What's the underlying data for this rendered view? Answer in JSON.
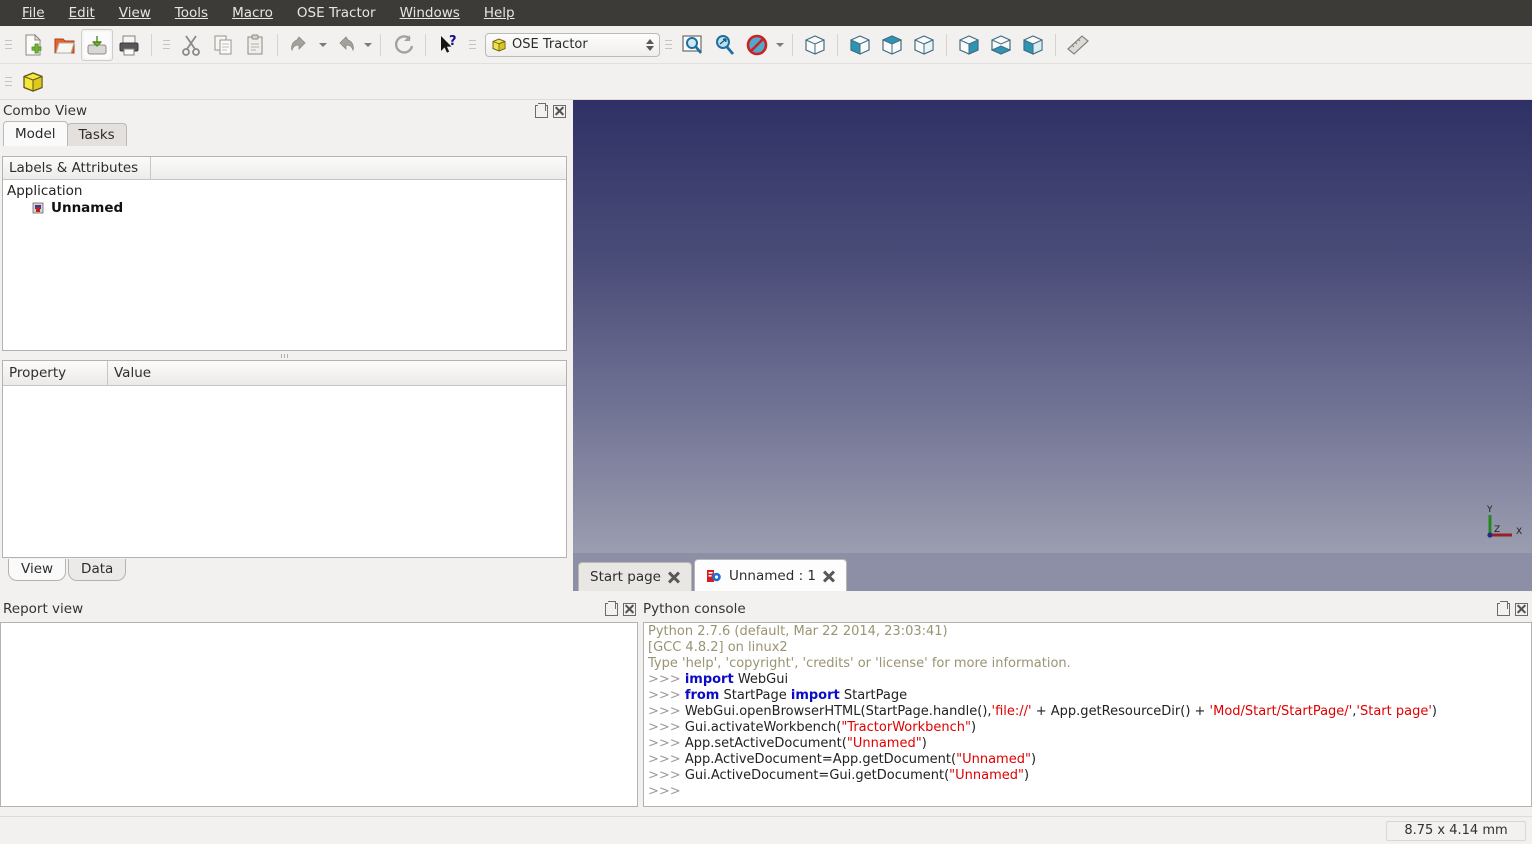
{
  "menubar": {
    "items": [
      {
        "label": "File",
        "mnemonic": "F"
      },
      {
        "label": "Edit",
        "mnemonic": "E"
      },
      {
        "label": "View",
        "mnemonic": "V"
      },
      {
        "label": "Tools",
        "mnemonic": "T"
      },
      {
        "label": "Macro",
        "mnemonic": "M"
      },
      {
        "label": "OSE Tractor",
        "mnemonic": ""
      },
      {
        "label": "Windows",
        "mnemonic": "W"
      },
      {
        "label": "Help",
        "mnemonic": "H"
      }
    ]
  },
  "toolbar": {
    "file": [
      {
        "name": "new-document-icon",
        "tip": "New"
      },
      {
        "name": "open-document-icon",
        "tip": "Open"
      },
      {
        "name": "save-document-icon",
        "tip": "Save"
      },
      {
        "name": "print-icon",
        "tip": "Print"
      }
    ],
    "edit": [
      {
        "name": "cut-icon",
        "tip": "Cut"
      },
      {
        "name": "copy-icon",
        "tip": "Copy"
      },
      {
        "name": "paste-icon",
        "tip": "Paste"
      },
      {
        "name": "undo-icon",
        "tip": "Undo"
      },
      {
        "name": "redo-icon",
        "tip": "Redo"
      },
      {
        "name": "refresh-icon",
        "tip": "Refresh"
      }
    ],
    "whats_this": {
      "name": "whats-this-icon",
      "tip": "What's This?"
    },
    "workbench": {
      "value": "OSE Tractor",
      "icon": "yellow-cube-icon"
    },
    "view_tools": [
      {
        "name": "fit-all-icon",
        "tip": "Fit all"
      },
      {
        "name": "zoom-box-icon",
        "tip": "Box zoom"
      },
      {
        "name": "draw-style-icon",
        "tip": "Draw style"
      }
    ],
    "std_views": [
      {
        "name": "isometric-view-icon",
        "tip": "Isometric"
      },
      {
        "name": "front-view-icon",
        "tip": "Front"
      },
      {
        "name": "top-view-icon",
        "tip": "Top"
      },
      {
        "name": "right-view-icon",
        "tip": "Right"
      },
      {
        "name": "rear-view-icon",
        "tip": "Rear"
      },
      {
        "name": "bottom-view-icon",
        "tip": "Bottom"
      },
      {
        "name": "left-view-icon",
        "tip": "Left"
      },
      {
        "name": "measure-icon",
        "tip": "Measure"
      }
    ],
    "workbench_tools": [
      {
        "name": "tractor-cube-icon",
        "tip": "OSE Tractor part"
      }
    ]
  },
  "combo_view": {
    "title": "Combo View",
    "tabs": [
      {
        "label": "Model",
        "active": true
      },
      {
        "label": "Tasks",
        "active": false
      }
    ],
    "tree": {
      "header": "Labels & Attributes",
      "root": "Application",
      "children": [
        {
          "label": "Unnamed",
          "icon": "document-icon"
        }
      ]
    },
    "properties": {
      "columns": [
        "Property",
        "Value"
      ],
      "rows": []
    },
    "bottom_tabs": [
      {
        "label": "View",
        "active": true
      },
      {
        "label": "Data",
        "active": false
      }
    ]
  },
  "mdi": {
    "tabs": [
      {
        "label": "Start page",
        "active": false,
        "icon": ""
      },
      {
        "label": "Unnamed : 1",
        "active": true,
        "icon": "freecad-logo-icon"
      }
    ],
    "axis": {
      "x": "X",
      "y": "Y",
      "z": "Z"
    }
  },
  "report_view": {
    "title": "Report view",
    "lines": []
  },
  "python_console": {
    "title": "Python console",
    "lines": [
      {
        "type": "banner",
        "text": "Python 2.7.6 (default, Mar 22 2014, 23:03:41)"
      },
      {
        "type": "banner",
        "text": "[GCC 4.8.2] on linux2"
      },
      {
        "type": "banner",
        "text": "Type 'help', 'copyright', 'credits' or 'license' for more information."
      },
      {
        "type": "code",
        "parts": [
          {
            "t": "prompt",
            "v": ">>> "
          },
          {
            "t": "kw",
            "v": "import"
          },
          {
            "t": "plain",
            "v": " WebGui"
          }
        ]
      },
      {
        "type": "code",
        "parts": [
          {
            "t": "prompt",
            "v": ">>> "
          },
          {
            "t": "kw",
            "v": "from"
          },
          {
            "t": "plain",
            "v": " StartPage "
          },
          {
            "t": "kw",
            "v": "import"
          },
          {
            "t": "plain",
            "v": " StartPage"
          }
        ]
      },
      {
        "type": "code",
        "parts": [
          {
            "t": "prompt",
            "v": ">>> "
          },
          {
            "t": "plain",
            "v": "WebGui.openBrowserHTML(StartPage.handle(),"
          },
          {
            "t": "str",
            "v": "'file://'"
          },
          {
            "t": "plain",
            "v": " + App.getResourceDir() + "
          },
          {
            "t": "str",
            "v": "'Mod/Start/StartPage/'"
          },
          {
            "t": "plain",
            "v": ","
          },
          {
            "t": "str",
            "v": "'Start page'"
          },
          {
            "t": "plain",
            "v": ")"
          }
        ]
      },
      {
        "type": "code",
        "parts": [
          {
            "t": "prompt",
            "v": ">>> "
          },
          {
            "t": "plain",
            "v": "Gui.activateWorkbench("
          },
          {
            "t": "str",
            "v": "\"TractorWorkbench\""
          },
          {
            "t": "plain",
            "v": ")"
          }
        ]
      },
      {
        "type": "code",
        "parts": [
          {
            "t": "prompt",
            "v": ">>> "
          },
          {
            "t": "plain",
            "v": "App.setActiveDocument("
          },
          {
            "t": "str",
            "v": "\"Unnamed\""
          },
          {
            "t": "plain",
            "v": ")"
          }
        ]
      },
      {
        "type": "code",
        "parts": [
          {
            "t": "prompt",
            "v": ">>> "
          },
          {
            "t": "plain",
            "v": "App.ActiveDocument=App.getDocument("
          },
          {
            "t": "str",
            "v": "\"Unnamed\""
          },
          {
            "t": "plain",
            "v": ")"
          }
        ]
      },
      {
        "type": "code",
        "parts": [
          {
            "t": "prompt",
            "v": ">>> "
          },
          {
            "t": "plain",
            "v": "Gui.ActiveDocument=Gui.getDocument("
          },
          {
            "t": "str",
            "v": "\"Unnamed\""
          },
          {
            "t": "plain",
            "v": ")"
          }
        ]
      },
      {
        "type": "code",
        "parts": [
          {
            "t": "prompt",
            "v": ">>> "
          }
        ]
      }
    ]
  },
  "statusbar": {
    "dimension": "8.75 x 4.14 mm"
  },
  "colors": {
    "menubar_bg": "#3c3b37",
    "toolbar_bg": "#f2f1f0",
    "view_top": "#2f3166",
    "view_bottom": "#9b9db0",
    "mdi_bar": "#8d8fa6",
    "string_red": "#e00000",
    "keyword_blue": "#0b0bc8",
    "banner_olive": "#9a9472"
  }
}
